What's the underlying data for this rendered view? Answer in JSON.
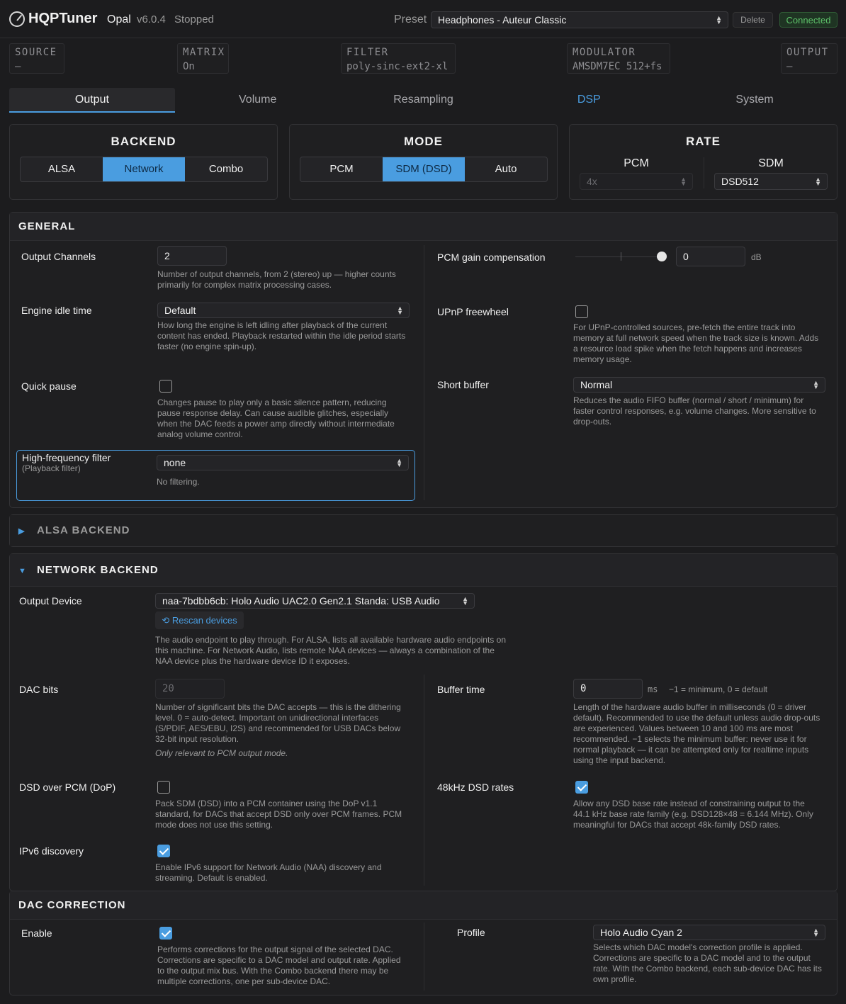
{
  "app": {
    "name": "HQPTuner",
    "profile": "Opal",
    "version": "v6.0.4",
    "status": "Stopped"
  },
  "header": {
    "preset_label": "Preset",
    "preset_value": "Headphones - Auteur Classic",
    "delete_label": "Delete",
    "connection_status": "Connected"
  },
  "pipeline": [
    {
      "label": "SOURCE",
      "value": "—"
    },
    {
      "label": "MATRIX",
      "value": "On"
    },
    {
      "label": "FILTER",
      "value": "poly-sinc-ext2-xl"
    },
    {
      "label": "MODULATOR",
      "value": "AMSDM7EC 512+fs"
    },
    {
      "label": "OUTPUT",
      "value": "—"
    }
  ],
  "tabs": [
    {
      "label": "Output",
      "active": true
    },
    {
      "label": "Volume"
    },
    {
      "label": "Resampling"
    },
    {
      "label": "DSP",
      "accent": true
    },
    {
      "label": "System"
    }
  ],
  "backend": {
    "title": "BACKEND",
    "options": [
      "ALSA",
      "Network",
      "Combo"
    ],
    "selected": "Network"
  },
  "mode": {
    "title": "MODE",
    "options": [
      "PCM",
      "SDM (DSD)",
      "Auto"
    ],
    "selected": "SDM (DSD)"
  },
  "rate": {
    "title": "RATE",
    "pcm_label": "PCM",
    "pcm_value": "4x",
    "sdm_label": "SDM",
    "sdm_value": "DSD512"
  },
  "general": {
    "title": "GENERAL",
    "output_channels": {
      "label": "Output Channels",
      "value": "2",
      "help": "Number of output channels, from 2 (stereo) up — higher counts primarily for complex matrix processing cases."
    },
    "engine_idle": {
      "label": "Engine idle time",
      "value": "Default",
      "help": "How long the engine is left idling after playback of the current content has ended. Playback restarted within the idle period starts faster (no engine spin-up)."
    },
    "quick_pause": {
      "label": "Quick pause",
      "checked": false,
      "help": "Changes pause to play only a basic silence pattern, reducing pause response delay. Can cause audible glitches, especially when the DAC feeds a power amp directly without intermediate analog volume control."
    },
    "hf_filter": {
      "label": "High-frequency filter",
      "sublabel": "(Playback filter)",
      "value": "none",
      "help": "No filtering."
    },
    "pcm_gain": {
      "label": "PCM gain compensation",
      "value": "0",
      "unit": "dB",
      "slider_fraction": 0.94
    },
    "upnp": {
      "label": "UPnP freewheel",
      "checked": false,
      "help": "For UPnP-controlled sources, pre-fetch the entire track into memory at full network speed when the track size is known. Adds a resource load spike when the fetch happens and increases memory usage."
    },
    "short_buffer": {
      "label": "Short buffer",
      "value": "Normal",
      "help": "Reduces the audio FIFO buffer (normal / short / minimum) for faster control responses, e.g. volume changes. More sensitive to drop-outs."
    }
  },
  "alsa_backend": {
    "title": "ALSA BACKEND",
    "expanded": false
  },
  "network_backend": {
    "title": "NETWORK BACKEND",
    "output_device": {
      "label": "Output Device",
      "value": "naa-7bdbb6cb: Holo Audio UAC2.0 Gen2.1 Standa: USB Audio",
      "rescan_label": "⟲ Rescan devices",
      "help": "The audio endpoint to play through. For ALSA, lists all available hardware audio endpoints on this machine. For Network Audio, lists remote NAA devices — always a combination of the NAA device plus the hardware device ID it exposes."
    },
    "dac_bits": {
      "label": "DAC bits",
      "value": "20",
      "help": "Number of significant bits the DAC accepts — this is the dithering level. 0 = auto-detect. Important on unidirectional interfaces (S/PDIF, AES/EBU, I2S) and recommended for USB DACs below 32-bit input resolution.",
      "note": "Only relevant to PCM output mode."
    },
    "buffer_time": {
      "label": "Buffer time",
      "value": "0",
      "unit": "ms",
      "hint": "−1 = minimum, 0 = default",
      "help": "Length of the hardware audio buffer in milliseconds (0 = driver default). Recommended to use the default unless audio drop-outs are experienced. Values between 10 and 100 ms are most recommended. −1 selects the minimum buffer: never use it for normal playback — it can be attempted only for realtime inputs using the input backend."
    },
    "dop": {
      "label": "DSD over PCM (DoP)",
      "checked": false,
      "help": "Pack SDM (DSD) into a PCM container using the DoP v1.1 standard, for DACs that accept DSD only over PCM frames. PCM mode does not use this setting."
    },
    "dsd48k": {
      "label": "48kHz DSD rates",
      "checked": true,
      "help": "Allow any DSD base rate instead of constraining output to the 44.1 kHz base rate family (e.g. DSD128×48 = 6.144 MHz). Only meaningful for DACs that accept 48k-family DSD rates."
    },
    "ipv6": {
      "label": "IPv6 discovery",
      "checked": true,
      "help": "Enable IPv6 support for Network Audio (NAA) discovery and streaming. Default is enabled."
    }
  },
  "dac_correction": {
    "title": "DAC CORRECTION",
    "enable": {
      "label": "Enable",
      "checked": true,
      "help": "Performs corrections for the output signal of the selected DAC. Corrections are specific to a DAC model and output rate. Applied to the output mix bus. With the Combo backend there may be multiple corrections, one per sub-device DAC."
    },
    "profile": {
      "label": "Profile",
      "value": "Holo Audio Cyan 2",
      "help": "Selects which DAC model's correction profile is applied. Corrections are specific to a DAC model and to the output rate. With the Combo backend, each sub-device DAC has its own profile."
    }
  },
  "colors": {
    "accent": "#4a9de0",
    "connected": "#5ec26a",
    "background": "#1c1c1e"
  }
}
